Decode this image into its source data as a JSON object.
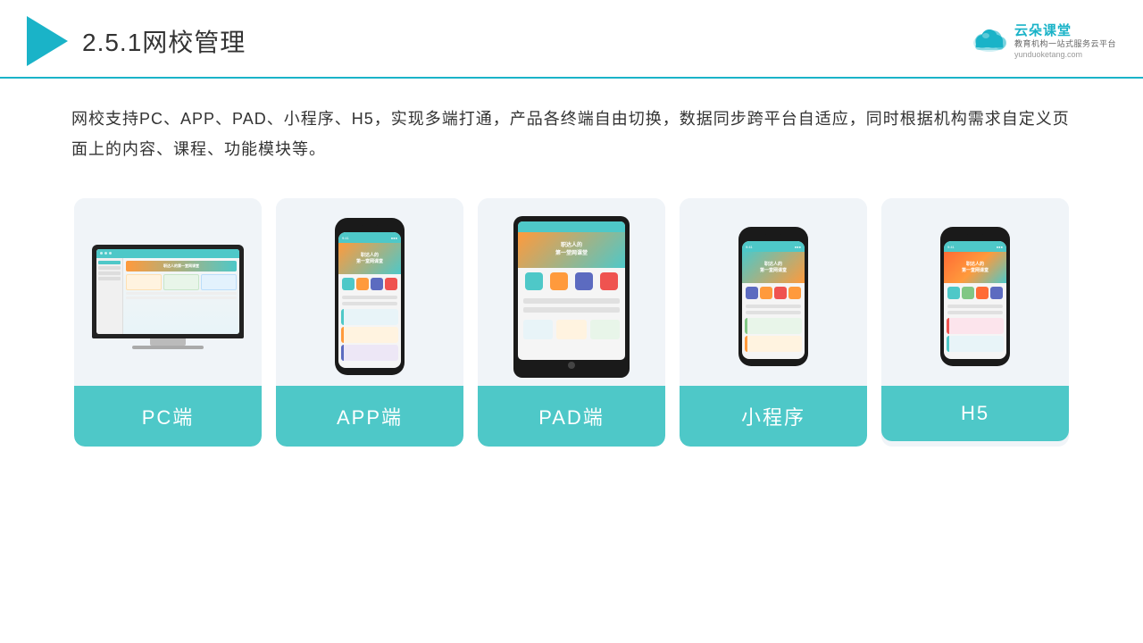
{
  "header": {
    "title": "2.5.1网校管理",
    "title_number": "2.5.1",
    "title_text": "网校管理",
    "divider_color": "#1ab3c8"
  },
  "brand": {
    "name": "云朵课堂",
    "url": "yunduoketang.com",
    "slogan_line1": "教育机构一站",
    "slogan_line2": "式服务云平台"
  },
  "description": {
    "text": "网校支持PC、APP、PAD、小程序、H5，实现多端打通，产品各终端自由切换，数据同步跨平台自适应，同时根据机构需求自定义页面上的内容、课程、功能模块等。"
  },
  "cards": [
    {
      "id": "pc",
      "label": "PC端"
    },
    {
      "id": "app",
      "label": "APP端"
    },
    {
      "id": "pad",
      "label": "PAD端"
    },
    {
      "id": "miniprogram",
      "label": "小程序"
    },
    {
      "id": "h5",
      "label": "H5"
    }
  ],
  "colors": {
    "teal": "#4ec8c8",
    "orange": "#ff9a3c",
    "bg_card": "#f0f4f8"
  }
}
